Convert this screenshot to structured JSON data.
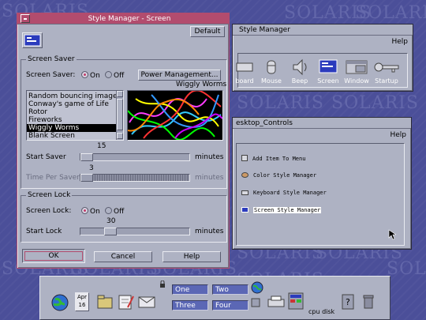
{
  "colors": {
    "desktop": "#4b4f99",
    "window_bg": "#aeb2c3",
    "active_title": "#b24c6e",
    "radio_selected": "#c23b69",
    "workspace_button": "#5b67b5"
  },
  "desktop": {
    "watermark": "SOLARIS"
  },
  "style_manager_small": {
    "title": "Style Manager",
    "help_menu": "Help",
    "icons": [
      {
        "label": "board",
        "icon": "keyboard-icon"
      },
      {
        "label": "Mouse",
        "icon": "mouse-icon"
      },
      {
        "label": "Beep",
        "icon": "speaker-icon"
      },
      {
        "label": "Screen",
        "icon": "screen-icon"
      },
      {
        "label": "Window",
        "icon": "window-icon"
      },
      {
        "label": "Startup",
        "icon": "key-icon"
      }
    ]
  },
  "desktop_controls": {
    "title": "esktop_Controls",
    "help_menu": "Help",
    "items": [
      {
        "label": "Add Item To Menu",
        "icon": "add-item-icon"
      },
      {
        "label": "Color Style Manager",
        "icon": "palette-icon"
      },
      {
        "label": "Keyboard Style Manager",
        "icon": "keyboard-icon"
      },
      {
        "label": "Screen Style Manager",
        "icon": "screen-icon"
      }
    ]
  },
  "screen_dialog": {
    "title": "Style Manager - Screen",
    "default_button": "Default",
    "screen_saver_group": "Screen Saver",
    "screen_saver_label": "Screen Saver:",
    "on_label": "On",
    "off_label": "Off",
    "power_button": "Power Management...",
    "preview_label": "Wiggly Worms",
    "savers": [
      {
        "label": "Random bouncing image",
        "selected": false
      },
      {
        "label": "Conway's game of Life",
        "selected": false
      },
      {
        "label": "Rotor",
        "selected": false
      },
      {
        "label": "Fireworks",
        "selected": false
      },
      {
        "label": "Wiggly Worms",
        "selected": true
      },
      {
        "label": "Blank Screen",
        "selected": false
      }
    ],
    "start_saver_label": "Start Saver",
    "start_saver_value": "15",
    "start_saver_units": "minutes",
    "time_per_saver_label": "Time Per Saver",
    "time_per_saver_value": "3",
    "time_per_saver_units": "minutes",
    "screen_lock_group": "Screen Lock",
    "screen_lock_label": "Screen Lock:",
    "lock_on_label": "On",
    "lock_off_label": "Off",
    "start_lock_label": "Start Lock",
    "start_lock_value": "30",
    "start_lock_units": "minutes",
    "ok_button": "OK",
    "cancel_button": "Cancel",
    "help_button": "Help"
  },
  "front_panel": {
    "calendar_month": "Apr",
    "calendar_day": "16",
    "workspaces": [
      "One",
      "Two",
      "Three",
      "Four"
    ],
    "cpu_disk_label": "cpu disk"
  }
}
